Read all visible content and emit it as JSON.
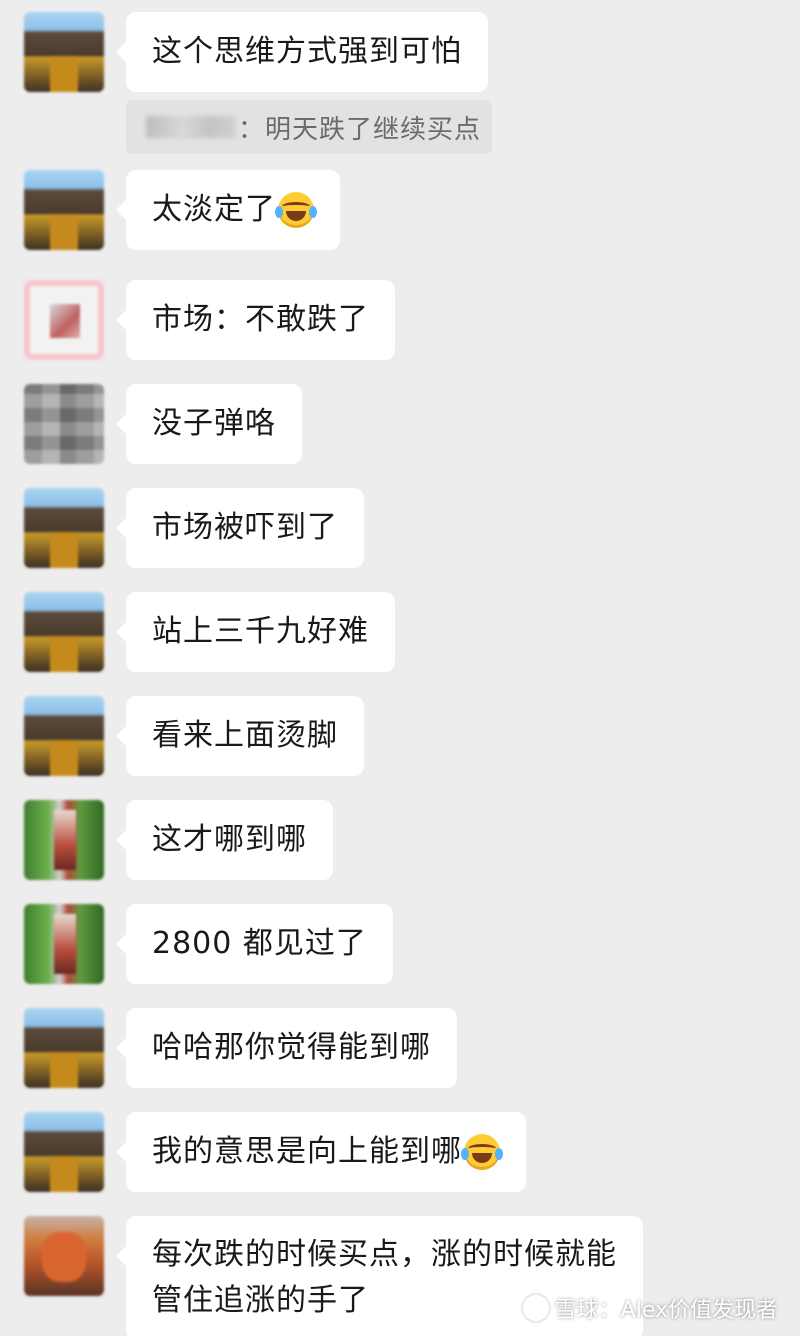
{
  "messages": [
    {
      "avatar_icon": "avatar-landscape-icon",
      "text": "这个思维方式强到可怕"
    },
    {
      "avatar_icon": "avatar-landscape-icon",
      "text": "太淡定了",
      "emoji": "laughing-crying-emoji"
    },
    {
      "avatar_icon": "avatar-pink-frame-icon",
      "text": "市场：不敢跌了"
    },
    {
      "avatar_icon": "avatar-gray-icon",
      "text": "没子弹咯"
    },
    {
      "avatar_icon": "avatar-landscape-icon",
      "text": "市场被吓到了"
    },
    {
      "avatar_icon": "avatar-landscape-icon",
      "text": "站上三千九好难"
    },
    {
      "avatar_icon": "avatar-landscape-icon",
      "text": "看来上面烫脚"
    },
    {
      "avatar_icon": "avatar-green-icon",
      "text": "这才哪到哪"
    },
    {
      "avatar_icon": "avatar-green-icon",
      "text": "2800 都见过了"
    },
    {
      "avatar_icon": "avatar-landscape-icon",
      "text": "哈哈那你觉得能到哪"
    },
    {
      "avatar_icon": "avatar-landscape-icon",
      "text": "我的意思是向上能到哪",
      "emoji": "crying-emoji"
    },
    {
      "avatar_icon": "avatar-orange-icon",
      "text_line1": "每次跌的时候买点，涨的时候就能",
      "text_line2": "管住追涨的手了"
    }
  ],
  "quote": {
    "text": "：明天跌了继续买点"
  },
  "watermark": {
    "text": "雪球：Alex价值发现者"
  }
}
